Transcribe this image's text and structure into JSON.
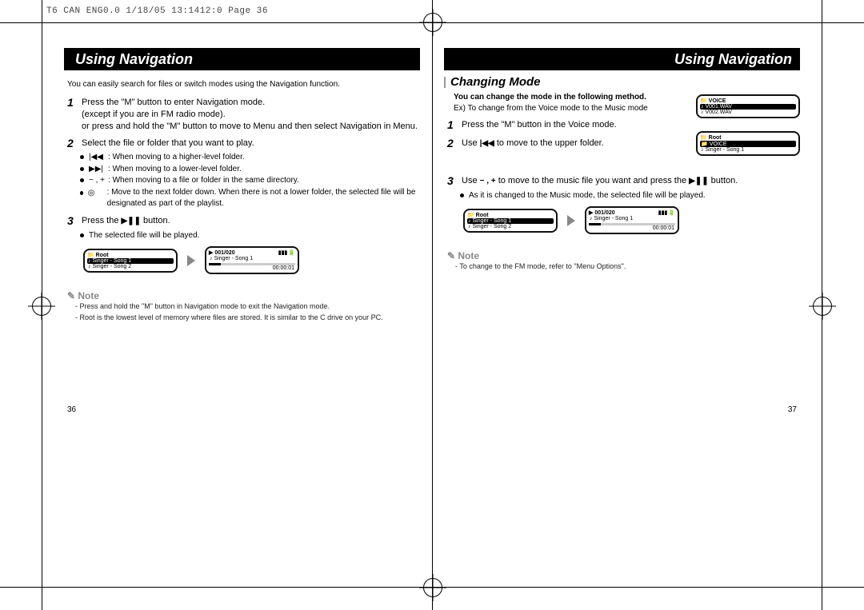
{
  "runhead": "T6 CAN ENG0.0  1/18/05 13:1412:0  Page 36",
  "page_left": {
    "title": "Using Navigation",
    "intro": "You can easily search for files or switch modes using the Navigation function.",
    "step1": "Press the \"M\" button to enter Navigation mode.\n(except if you are in FM radio mode).\nor press and hold the \"M\" button to move to Menu and then select Navigation in Menu.",
    "step2": "Select the file or folder that you want to play.",
    "sub2_a_sym": "|◀◀",
    "sub2_a": "When moving to a higher-level folder.",
    "sub2_b_sym": "▶▶|",
    "sub2_b": "When moving to a lower-level folder.",
    "sub2_c_sym": "− , +",
    "sub2_c": "When moving to a file or folder in the same directory.",
    "sub2_d_sym": "◎",
    "sub2_d": "Move to the next folder down. When there is not a lower folder, the selected file will be designated as part of the playlist.",
    "step3_pre": "Press the ",
    "step3_sym": "▶❚❚",
    "step3_post": " button.",
    "sub3": "The selected file will be played.",
    "lcd1": {
      "hdr": "Root",
      "row1": "Singer - Song 1",
      "row2": "Singer - Song 2"
    },
    "lcd2": {
      "hdr": "▶ 001/020",
      "row1": "♪ Singer - Song 1",
      "time": "00:00:01"
    },
    "note_label": "✎ Note",
    "note1": "- Press and hold the \"M\" button in Navigation mode to exit the Navigation mode.",
    "note2": "- Root is the lowest level of memory where files are stored. It is similar to the C drive on your PC.",
    "pagenum": "36"
  },
  "page_right": {
    "title": "Using Navigation",
    "section": "Changing Mode",
    "changeline": "You can change the mode in the following method.",
    "example": "Ex) To change from the Voice mode to the Music mode",
    "step1": "Press the \"M\" button in the Voice mode.",
    "step2_pre": "Use ",
    "step2_sym": "|◀◀",
    "step2_post": " to move to the upper folder.",
    "step3_pre": "Use ",
    "step3_sym1": "− , +",
    "step3_mid": " to move to the music file you want and press the ",
    "step3_sym2": "▶❚❚",
    "step3_post": " button.",
    "sub3": "As it is changed to the Music mode, the selected file will be played.",
    "lcdA": {
      "hdr": "VOICE",
      "row1": "V001.WAV",
      "row2": "V002.WAV"
    },
    "lcdB": {
      "hdr": "Root",
      "row1": "VOICE",
      "row2": "Singer - Song 1"
    },
    "lcdC": {
      "hdr": "Root",
      "row1": "Singer - Song 1",
      "row2": "Singer - Song 2"
    },
    "lcdD": {
      "hdr": "▶ 001/020",
      "row1": "♪ Singer - Song 1",
      "time": "00:00:01"
    },
    "note_label": "✎ Note",
    "note1": "- To change to the FM mode, refer to \"Menu Options\".",
    "pagenum": "37"
  }
}
